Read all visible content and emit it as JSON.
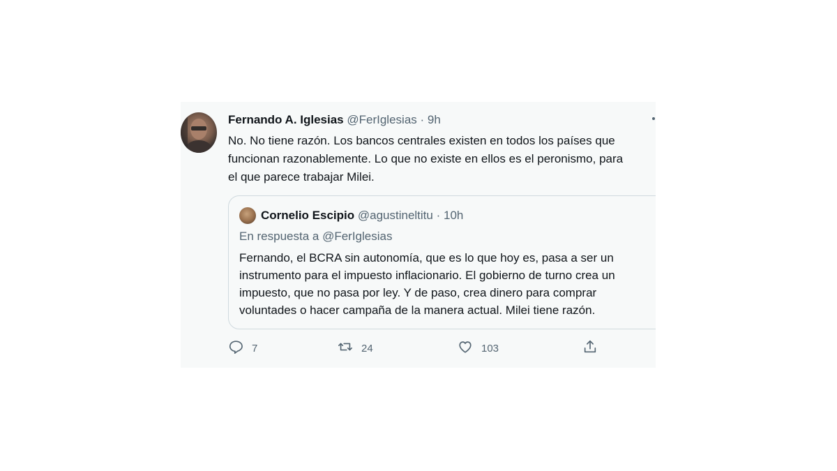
{
  "tweet": {
    "author_name": "Fernando A. Iglesias",
    "handle": "@FerIglesias",
    "separator": "·",
    "time": "9h",
    "text_lines": [
      "No. No tiene razón. Los bancos centrales existen en todos los países que",
      "funcionan razonablemente. Lo que no existe en ellos es el peronismo, para",
      "el que parece trabajar Milei."
    ]
  },
  "quote": {
    "author_name": "Cornelio Escipio",
    "handle": "@agustineltitu",
    "separator": "·",
    "time": "10h",
    "reply_to": "En respuesta a @FerIglesias",
    "text_lines": [
      "Fernando, el BCRA sin autonomía, que es lo que hoy es, pasa a ser un",
      "instrumento para el impuesto inflacionario. El gobierno de turno crea un",
      "impuesto, que no pasa por ley. Y de paso, crea dinero para comprar",
      "voluntades o hacer campaña de la manera actual. Milei tiene razón."
    ]
  },
  "actions": {
    "reply": {
      "icon": "reply-icon",
      "count": "7"
    },
    "retweet": {
      "icon": "retweet-icon",
      "count": "24"
    },
    "like": {
      "icon": "heart-icon",
      "count": "103"
    },
    "share": {
      "icon": "share-icon"
    }
  },
  "colors": {
    "text": "#0f1419",
    "secondary": "#536471",
    "card_background": "#f7f9f9",
    "border": "#cfd9de"
  }
}
